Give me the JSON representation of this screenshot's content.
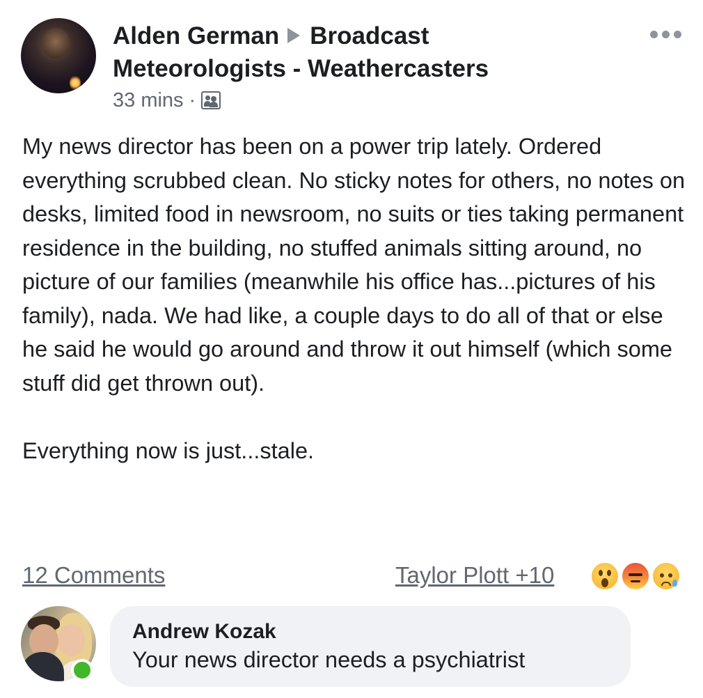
{
  "post": {
    "author": "Alden German",
    "group": "Broadcast Meteorologists - Weathercasters",
    "timestamp": "33 mins",
    "separator": "·",
    "privacy_icon": "group-members-icon",
    "body_paragraph_1": "My news director has been on a power trip lately. Ordered everything scrubbed clean. No sticky notes for others, no notes on desks, limited food in newsroom, no suits or ties taking permanent residence in the building, no stuffed animals sitting around, no picture of our families (meanwhile his office has...pictures of his family), nada. We had like, a couple days to do all of that or else he said he would go around and throw it out himself (which some stuff did get thrown out).",
    "body_paragraph_2": "Everything now is just...stale."
  },
  "footer": {
    "comments_label": "12 Comments",
    "reactors_label": "Taylor Plott +10",
    "reactions": [
      "wow-emoji-icon",
      "angry-emoji-icon",
      "sad-emoji-icon"
    ]
  },
  "comment": {
    "author": "Andrew Kozak",
    "text": "Your news director needs a psychiatrist",
    "online": true
  },
  "colors": {
    "text": "#1c1e21",
    "secondary": "#606770",
    "bubble": "#f0f2f5",
    "online": "#42b72a"
  }
}
